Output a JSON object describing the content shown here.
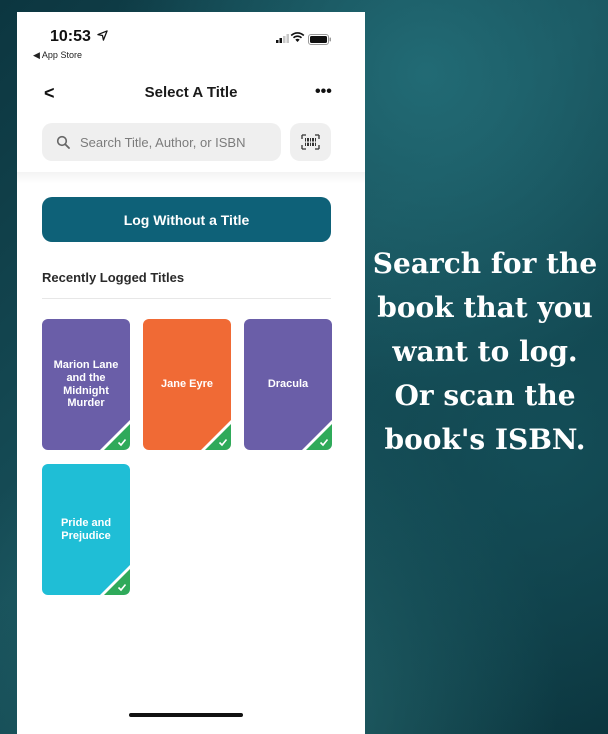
{
  "status_bar": {
    "time": "10:53",
    "back_app": "◀ App Store"
  },
  "nav": {
    "back_glyph": "<",
    "title": "Select A Title",
    "more_glyph": "•••"
  },
  "search": {
    "placeholder": "Search Title, Author, or ISBN"
  },
  "log_button": {
    "label": "Log Without a Title"
  },
  "recent": {
    "heading": "Recently Logged Titles",
    "books": [
      {
        "title": "Marion Lane and the Midnight Murder",
        "color": "#6a5ea8"
      },
      {
        "title": "Jane Eyre",
        "color": "#f06a35"
      },
      {
        "title": "Dracula",
        "color": "#6a5ea8"
      },
      {
        "title": "Pride and Prejudice",
        "color": "#1fbed6"
      }
    ]
  },
  "caption": {
    "lines": [
      "Search for the",
      "book that you",
      "want to log.",
      "Or scan the",
      "book's ISBN."
    ]
  },
  "colors": {
    "accent": "#0e6178",
    "check_green": "#2faa5a"
  },
  "icons": [
    "location-arrow-icon",
    "signal-icon",
    "wifi-icon",
    "battery-icon",
    "back-chevron-icon",
    "more-icon",
    "search-icon",
    "barcode-scan-icon",
    "check-icon"
  ]
}
